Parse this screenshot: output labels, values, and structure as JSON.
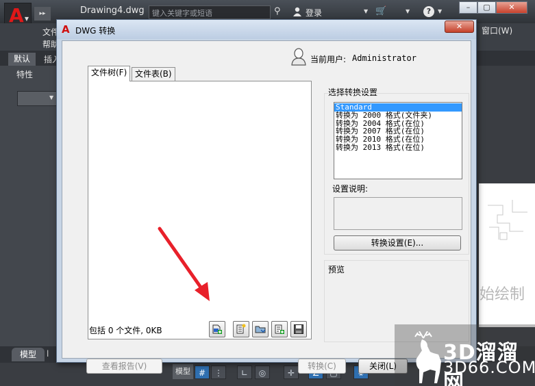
{
  "autocad": {
    "doc_title": "Drawing4.dwg",
    "search_placeholder": "键入关键字或短语",
    "login": "登录",
    "menu_file": "文件",
    "menu_help": "帮助",
    "menu_window": "窗口(W)",
    "ribbon_tab_default": "默认",
    "ribbon_tab_insert": "插入",
    "properties_label": "特性",
    "drawing_text": "始绘制",
    "model_tab": "模型",
    "status_model": "模型"
  },
  "dialog": {
    "title": "DWG 转换",
    "current_user_label": "当前用户:",
    "current_user": "Administrator",
    "tabs": [
      "文件树(F)",
      "文件表(B)"
    ],
    "file_count": "包括 0 个文件, 0KB",
    "select_settings_label": "选择转换设置",
    "settings": [
      "Standard",
      "转换为 2000 格式(文件夹)",
      "转换为 2004 格式(在位)",
      "转换为 2007 格式(在位)",
      "转换为 2010 格式(在位)",
      "转换为 2013 格式(在位)"
    ],
    "selected_setting_index": 0,
    "description_label": "设置说明:",
    "convert_settings_button": "转换设置(E)...",
    "preview_label": "预览",
    "view_report_button": "查看报告(V)",
    "convert_button": "转换(C)",
    "close_button": "关闭(L)"
  },
  "watermark": {
    "line1": "3D溜溜网",
    "line2": "3D66.COM"
  },
  "colors": {
    "accent": "#3399ff",
    "autocad_red": "#d01010",
    "arrow": "#e8202a"
  }
}
